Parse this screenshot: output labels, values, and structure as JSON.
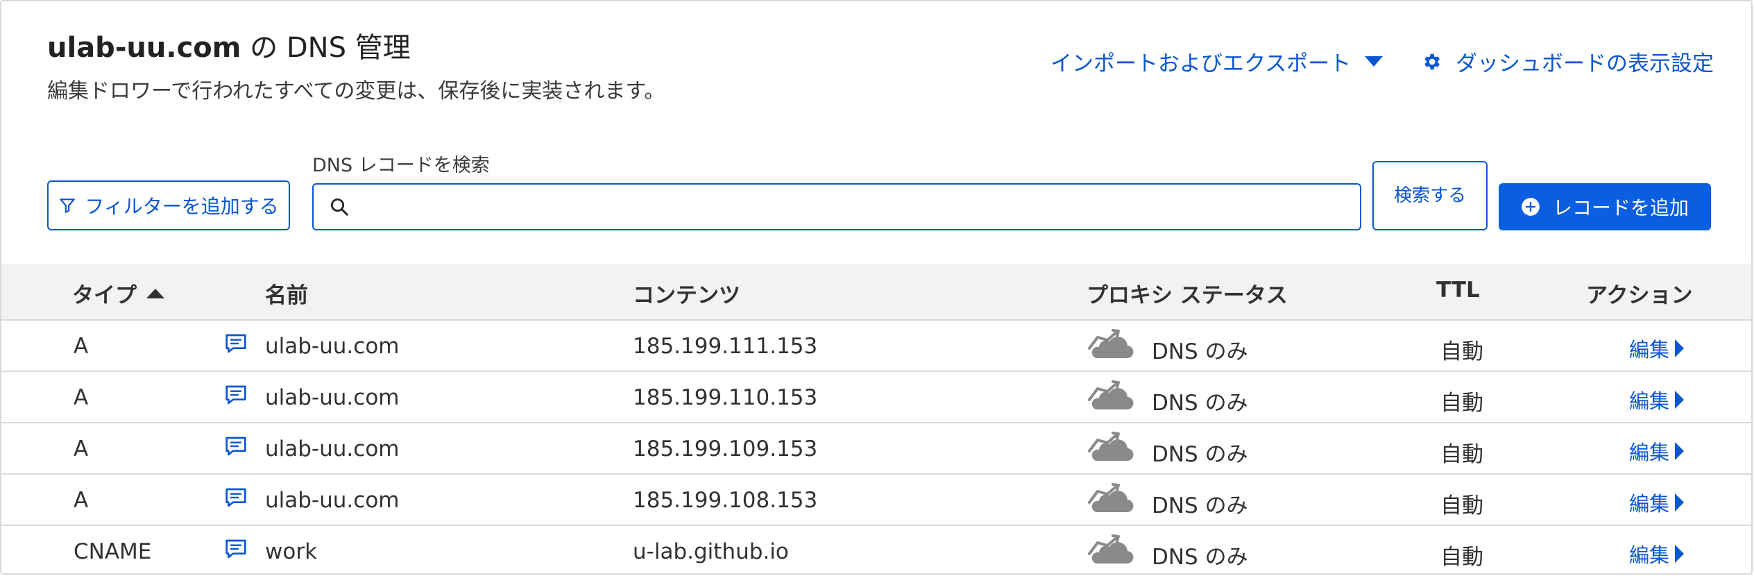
{
  "header": {
    "domain": "ulab-uu.com",
    "title_suffix": " の DNS 管理",
    "subtitle": "編集ドロワーで行われたすべての変更は、保存後に実装されます。",
    "import_export_label": "インポートおよびエクスポート",
    "dashboard_settings_label": "ダッシュボードの表示設定"
  },
  "toolbar": {
    "filter_label": "フィルターを追加する",
    "search_label": "DNS レコードを検索",
    "search_value": "",
    "search_button_label": "検索する",
    "add_record_label": "レコードを追加"
  },
  "table": {
    "columns": {
      "type": "タイプ",
      "name": "名前",
      "content": "コンテンツ",
      "proxy": "プロキシ ステータス",
      "ttl": "TTL",
      "actions": "アクション"
    },
    "rows": [
      {
        "type": "A",
        "name": "ulab-uu.com",
        "content": "185.199.111.153",
        "proxy": "DNS のみ",
        "ttl": "自動",
        "action": "編集"
      },
      {
        "type": "A",
        "name": "ulab-uu.com",
        "content": "185.199.110.153",
        "proxy": "DNS のみ",
        "ttl": "自動",
        "action": "編集"
      },
      {
        "type": "A",
        "name": "ulab-uu.com",
        "content": "185.199.109.153",
        "proxy": "DNS のみ",
        "ttl": "自動",
        "action": "編集"
      },
      {
        "type": "A",
        "name": "ulab-uu.com",
        "content": "185.199.108.153",
        "proxy": "DNS のみ",
        "ttl": "自動",
        "action": "編集"
      },
      {
        "type": "CNAME",
        "name": "work",
        "content": "u-lab.github.io",
        "proxy": "DNS のみ",
        "ttl": "自動",
        "action": "編集"
      }
    ]
  },
  "colors": {
    "accent": "#0a56d1",
    "primary_button": "#0a5fe0",
    "header_bg": "#f2f2f2",
    "cloud_gray": "#8a8a8a"
  },
  "icons": {
    "gear": "gear-icon",
    "filter": "filter-icon",
    "search": "search-icon",
    "add": "plus-circle-icon",
    "comment": "comment-icon",
    "proxy": "cloud-dns-only-icon"
  }
}
